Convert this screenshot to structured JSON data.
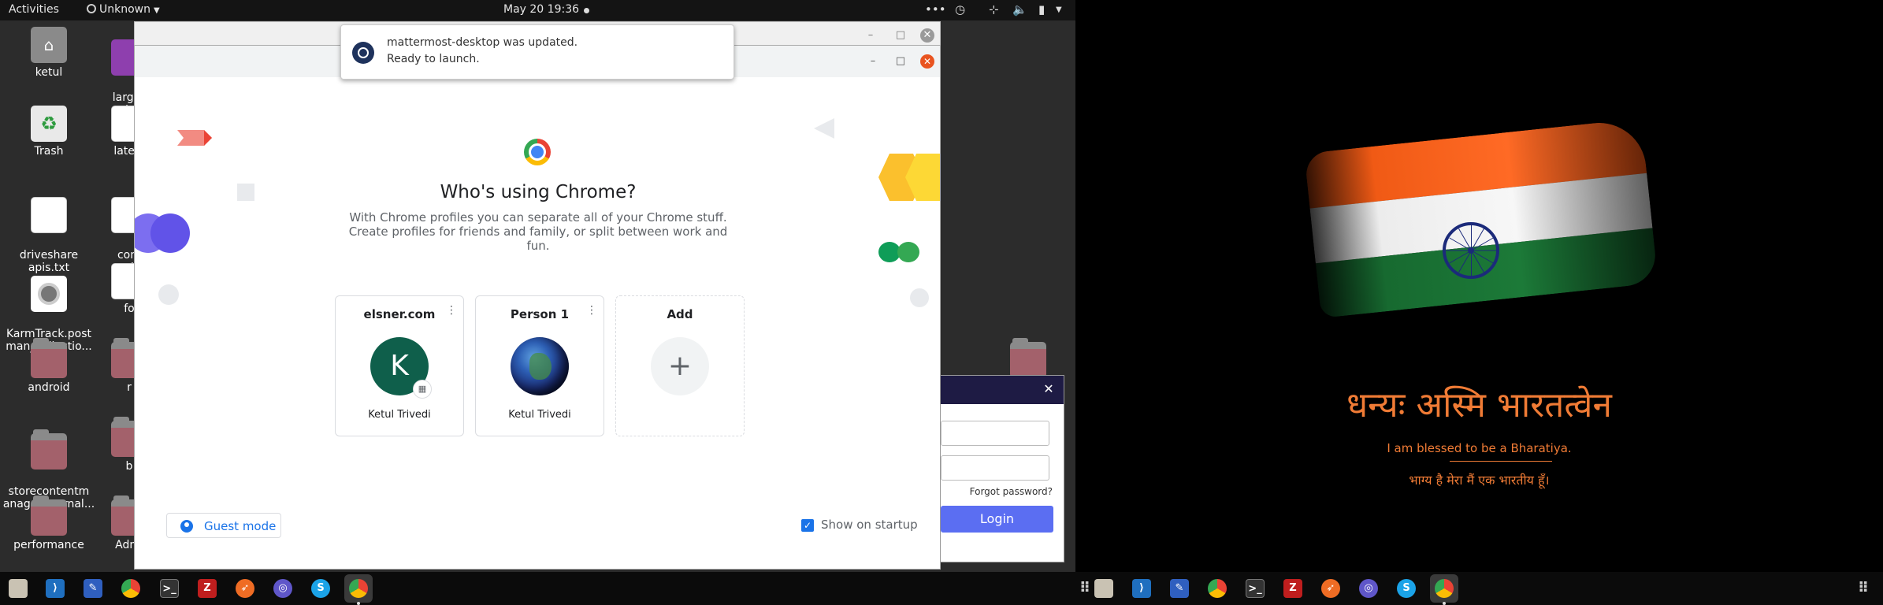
{
  "topbar": {
    "activities": "Activities",
    "app_menu": "Unknown",
    "clock": "May 20  19:36"
  },
  "desktop_icons": [
    {
      "label": "ketul",
      "type": "home"
    },
    {
      "label": "Trash",
      "type": "trash"
    },
    {
      "label": "driveshare\napis.txt",
      "type": "text"
    },
    {
      "label": "KarmTrack.post\nman_collectio...",
      "type": "postman"
    },
    {
      "label": "android",
      "type": "folder"
    },
    {
      "label": "storecontentm\nanagerinternal...",
      "type": "folder"
    },
    {
      "label": "performance",
      "type": "folder"
    }
  ],
  "desktop_icons_col2_partial": [
    "large_\nerkze",
    "latest",
    "conf\nwebs",
    "fo",
    "r",
    "b",
    "Admi"
  ],
  "notification": {
    "title": "mattermost-desktop was updated.",
    "body": "Ready to launch."
  },
  "chrome": {
    "heading": "Who's using Chrome?",
    "subtext": "With Chrome profiles you can separate all of your Chrome stuff. Create profiles for friends and family, or split between work and fun.",
    "profiles": [
      {
        "title": "elsner.com",
        "initial": "K",
        "name": "Ketul Trivedi"
      },
      {
        "title": "Person 1",
        "name": "Ketul Trivedi"
      }
    ],
    "add_label": "Add",
    "add_symbol": "+",
    "guest_label": "Guest mode",
    "startup_label": "Show on startup",
    "startup_checked": true,
    "colors": {
      "accent": "#1a73e8",
      "avatar_k": "#0f5f4b"
    }
  },
  "mattermost": {
    "forgot": "Forgot password?",
    "login": "Login",
    "close_icon": "close-icon"
  },
  "wallpaper": {
    "hindi_title": "धन्यः अस्मि भारतत्वेन",
    "english_line": "I am blessed to be a Bharatiya.",
    "hindi_line": "भाग्य है मेरा मैं एक भारतीय हूँ।"
  },
  "taskbar_icons": [
    "files-icon",
    "vscode-icon",
    "text-editor-icon",
    "chrome-icon",
    "terminal-icon",
    "filezilla-icon",
    "postman-icon",
    "mattermost-icon",
    "skype-icon",
    "chrome-active-icon"
  ]
}
